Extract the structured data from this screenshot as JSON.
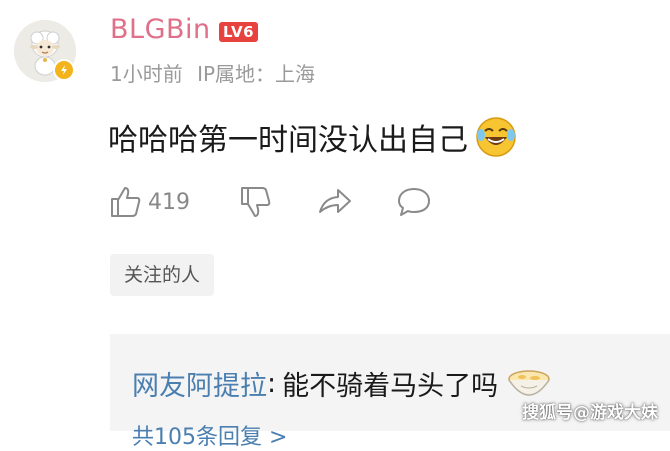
{
  "comment": {
    "username": "BLGBin",
    "level_badge": "LV6",
    "time": "1小时前",
    "ip_location": "IP属地：上海",
    "text": "哈哈哈第一时间没认出自己",
    "emoji": "laughing-crying-icon"
  },
  "actions": {
    "like_count": "419"
  },
  "tag_chip": "关注的人",
  "reply": {
    "username": "网友阿提拉",
    "separator": ":",
    "text": "能不骑着马头了吗",
    "emoji": "bowl-icon",
    "more": "共105条回复 >"
  },
  "watermark": "搜狐号@游戏大妹",
  "colors": {
    "username": "#e0708a",
    "level_badge": "#e8423f",
    "reply_user": "#4a7fb0",
    "vip_badge": "#f2b41a"
  }
}
